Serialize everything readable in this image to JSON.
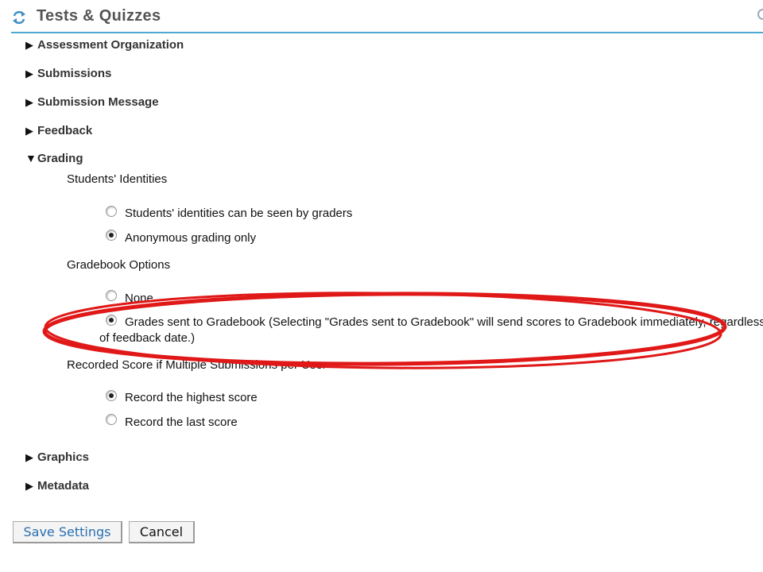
{
  "header": {
    "title": "Tests & Quizzes",
    "icon": "refresh-arrows-icon"
  },
  "sections": {
    "assessment_organization": "Assessment Organization",
    "submissions": "Submissions",
    "submission_message": "Submission Message",
    "feedback": "Feedback",
    "grading": "Grading",
    "graphics": "Graphics",
    "metadata": "Metadata"
  },
  "grading": {
    "identities": {
      "label": "Students' Identities",
      "options": [
        {
          "label": "Students' identities can be seen by graders",
          "checked": false
        },
        {
          "label": "Anonymous grading only",
          "checked": true
        }
      ]
    },
    "gradebook": {
      "label": "Gradebook Options",
      "options": [
        {
          "label": "None",
          "checked": false
        },
        {
          "label": "Grades sent to Gradebook (Selecting \"Grades sent to Gradebook\" will send scores to Gradebook immediately, regardless of feedback date.)",
          "checked": true
        }
      ]
    },
    "recorded_score": {
      "label": "Recorded Score if Multiple Submissions per User",
      "options": [
        {
          "label": "Record the highest score",
          "checked": true
        },
        {
          "label": "Record the last score",
          "checked": false
        }
      ]
    }
  },
  "buttons": {
    "save": "Save Settings",
    "cancel": "Cancel"
  },
  "colors": {
    "accent_rule": "#4fa8d4",
    "highlight": "#e01818",
    "save_text": "#2a6fb0"
  }
}
